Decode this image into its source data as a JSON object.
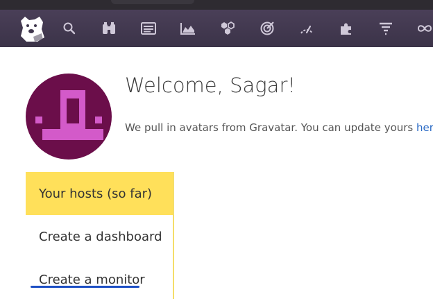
{
  "nav": {
    "logo": "datadog-logo",
    "icons": [
      "search-icon",
      "binoculars-icon",
      "dashboard-icon",
      "metrics-icon",
      "integrations-icon",
      "monitors-icon",
      "apm-icon",
      "plugins-icon",
      "logs-icon",
      "infinity-icon"
    ]
  },
  "welcome": {
    "title": "Welcome, Sagar!",
    "subtext_prefix": "We pull in avatars from Gravatar. You can update yours ",
    "subtext_link": "here",
    "subtext_suffix": "!"
  },
  "steps": {
    "items": [
      {
        "label": "Your hosts (so far)",
        "active": true
      },
      {
        "label": "Create a dashboard",
        "active": false
      },
      {
        "label": "Create a monitor",
        "active": false
      }
    ]
  },
  "colors": {
    "nav_bg": "#40374d",
    "avatar_bg": "#6b0e4a",
    "avatar_fg": "#d35ac9",
    "active_step": "#ffe05a",
    "link": "#2a6ac5"
  }
}
